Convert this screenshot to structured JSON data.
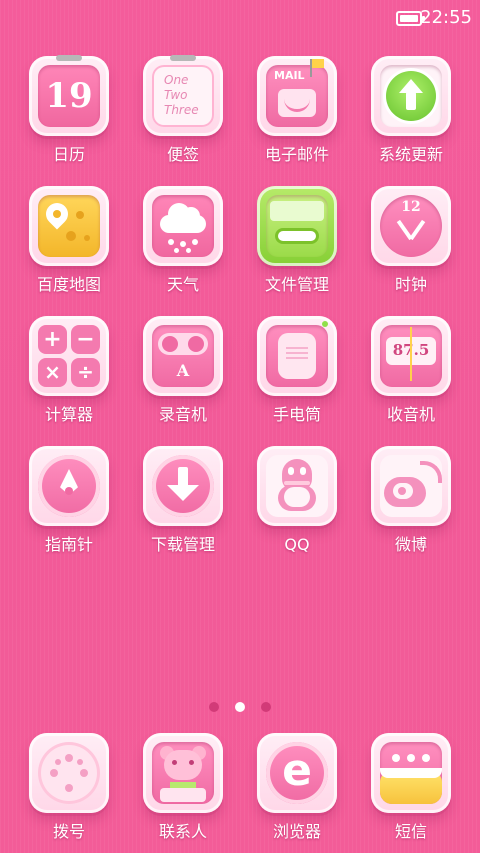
{
  "status_bar": {
    "time": "22:55"
  },
  "apps": [
    {
      "label": "日历",
      "icon": "calendar-icon",
      "glyph": "19"
    },
    {
      "label": "便签",
      "icon": "notes-icon",
      "lines": [
        "One",
        "Two",
        "Three"
      ]
    },
    {
      "label": "电子邮件",
      "icon": "mail-icon",
      "glyph": "MAIL"
    },
    {
      "label": "系统更新",
      "icon": "update-icon"
    },
    {
      "label": "百度地图",
      "icon": "map-icon"
    },
    {
      "label": "天气",
      "icon": "weather-icon"
    },
    {
      "label": "文件管理",
      "icon": "file-manager-icon"
    },
    {
      "label": "时钟",
      "icon": "clock-icon",
      "glyph": "12"
    },
    {
      "label": "计算器",
      "icon": "calculator-icon"
    },
    {
      "label": "录音机",
      "icon": "recorder-icon",
      "glyph": "A"
    },
    {
      "label": "手电筒",
      "icon": "flashlight-icon"
    },
    {
      "label": "收音机",
      "icon": "radio-icon",
      "glyph": "87.5"
    },
    {
      "label": "指南针",
      "icon": "compass-icon"
    },
    {
      "label": "下载管理",
      "icon": "download-icon"
    },
    {
      "label": "QQ",
      "icon": "qq-icon"
    },
    {
      "label": "微博",
      "icon": "weibo-icon"
    }
  ],
  "dock": [
    {
      "label": "拨号",
      "icon": "dialer-icon"
    },
    {
      "label": "联系人",
      "icon": "contacts-icon"
    },
    {
      "label": "浏览器",
      "icon": "browser-icon",
      "glyph": "e"
    },
    {
      "label": "短信",
      "icon": "messages-icon"
    }
  ],
  "page_indicator": {
    "count": 3,
    "active": 2
  }
}
